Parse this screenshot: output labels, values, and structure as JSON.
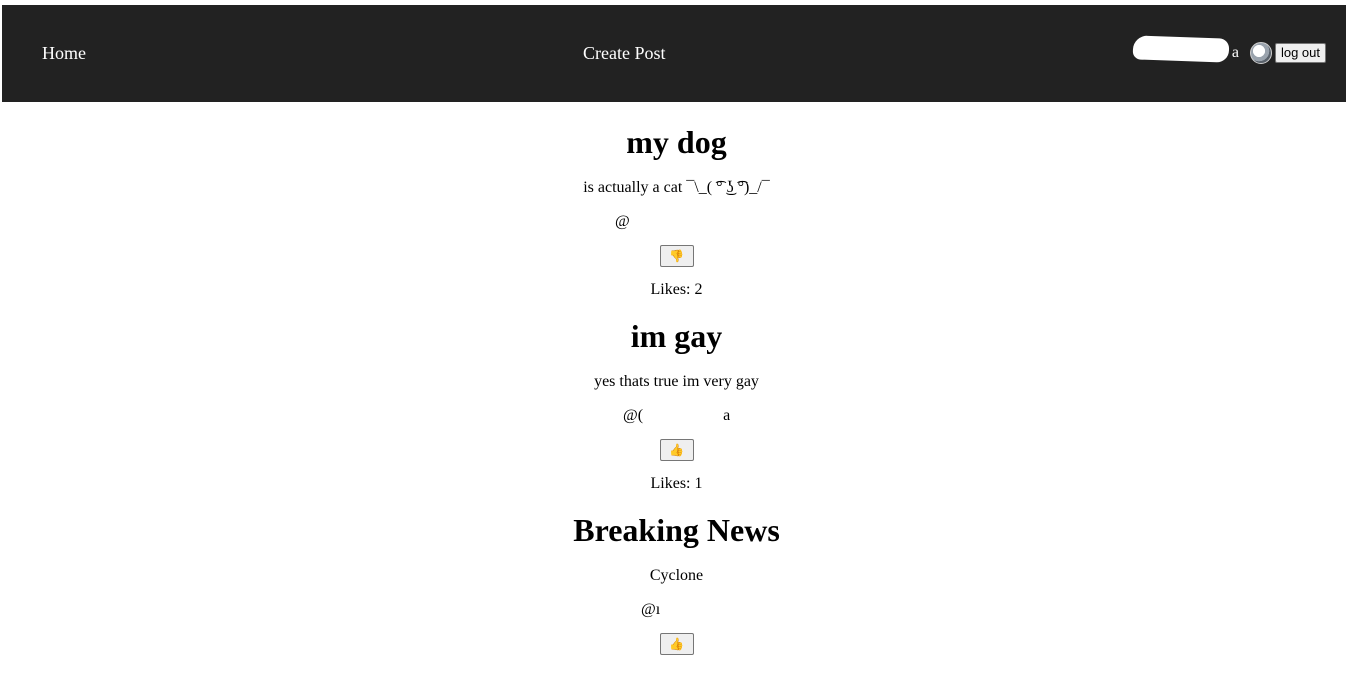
{
  "nav": {
    "home": "Home",
    "create_post": "Create Post",
    "user_suffix": "a",
    "logout": "log out"
  },
  "posts": [
    {
      "title": "my dog",
      "body": "is actually a cat ¯\\_( ͡° ͜ʖ ͡°)_/¯",
      "author": "@",
      "like_icon": "👎",
      "likes": "Likes: 2"
    },
    {
      "title": "im gay",
      "body": "yes thats true im very gay",
      "author": "@(                    a",
      "like_icon": "👍",
      "likes": "Likes: 1"
    },
    {
      "title": "Breaking News",
      "body": "Cyclone",
      "author": "@ı",
      "like_icon": "👍"
    }
  ],
  "colors": {
    "navbar_bg": "#222222",
    "nav_text": "#ffffff"
  },
  "icons": {
    "dislike": "thumbs-down-icon",
    "like": "thumbs-up-icon",
    "avatar": "user-avatar"
  }
}
